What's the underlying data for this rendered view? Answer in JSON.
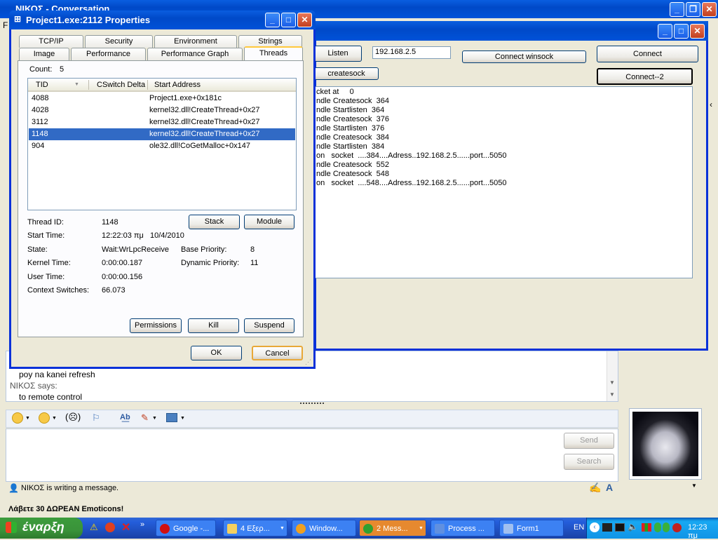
{
  "messenger": {
    "title": "ΝΙΚΟΣ - Conversation",
    "menu_letter": "F",
    "chat_lines": [
      {
        "text": "poy na  kanei  refresh",
        "indent": true
      },
      {
        "text": "ΝΙΚΟΣ says:",
        "indent": false
      },
      {
        "text": "to remote control",
        "indent": true
      }
    ],
    "send_label": "Send",
    "search_label": "Search",
    "status_text": "ΝΙΚΟΣ is writing a message.",
    "promo_text": "Λάβετε 30 ΔΩΡΕΑΝ Emoticons!"
  },
  "form1": {
    "listen_label": "Listen",
    "ip_value": "192.168.2.5",
    "connect_winsock_label": "Connect winsock",
    "connect_label": "Connect",
    "createsock_label": "createsock",
    "connect2_label": "Connect--2",
    "log_lines": [
      "cket at     0",
      "ndle Createsock  364",
      "ndle Startlisten  364",
      "ndle Createsock  376",
      "ndle Startlisten  376",
      "ndle Createsock  384",
      "ndle Startlisten  384",
      "on   socket  ....384....Adress..192.168.2.5......port...5050",
      "ndle Createsock  552",
      "ndle Createsock  548",
      "on   socket  ....548....Adress..192.168.2.5......port...5050"
    ]
  },
  "props": {
    "title": "Project1.exe:2112 Properties",
    "tabs_row1": [
      "TCP/IP",
      "Security",
      "Environment",
      "Strings"
    ],
    "tabs_row2": [
      "Image",
      "Performance",
      "Performance Graph",
      "Threads"
    ],
    "count_label": "Count:",
    "count_value": "5",
    "columns": [
      "TID",
      "CSwitch Delta",
      "Start Address"
    ],
    "threads": [
      {
        "tid": "4088",
        "addr": "Project1.exe+0x181c"
      },
      {
        "tid": "4028",
        "addr": "kernel32.dll!CreateThread+0x27"
      },
      {
        "tid": "3112",
        "addr": "kernel32.dll!CreateThread+0x27"
      },
      {
        "tid": "1148",
        "addr": "kernel32.dll!CreateThread+0x27"
      },
      {
        "tid": "904",
        "addr": "ole32.dll!CoGetMalloc+0x147"
      }
    ],
    "thread_id_label": "Thread ID:",
    "thread_id": "1148",
    "start_time_label": "Start Time:",
    "start_time": "12:22:03 πμ   10/4/2010",
    "state_label": "State:",
    "state": "Wait:WrLpcReceive",
    "base_priority_label": "Base Priority:",
    "base_priority": "8",
    "kernel_time_label": "Kernel Time:",
    "kernel_time": "0:00:00.187",
    "dynamic_priority_label": "Dynamic Priority:",
    "dynamic_priority": "11",
    "user_time_label": "User Time:",
    "user_time": "0:00:00.156",
    "context_switches_label": "Context Switches:",
    "context_switches": "66.073",
    "stack_label": "Stack",
    "module_label": "Module",
    "permissions_label": "Permissions",
    "kill_label": "Kill",
    "suspend_label": "Suspend",
    "ok_label": "OK",
    "cancel_label": "Cancel"
  },
  "taskbar": {
    "start_label": "έναρξη",
    "items": [
      "Google -...",
      "4 Εξερ...",
      "Window...",
      "2 Mess...",
      "Process ...",
      "Form1"
    ],
    "lang": "EN",
    "clock": "12:23 πμ"
  }
}
